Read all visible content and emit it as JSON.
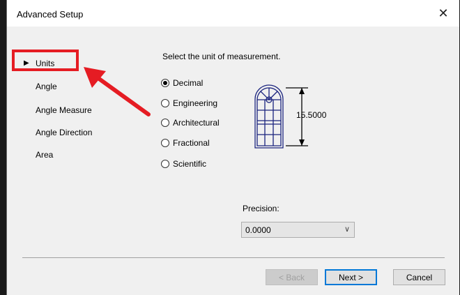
{
  "window": {
    "title": "Advanced Setup",
    "close_symbol": "✕"
  },
  "sidebar": {
    "items": [
      {
        "label": "Units",
        "selected": true
      },
      {
        "label": "Angle"
      },
      {
        "label": "Angle Measure"
      },
      {
        "label": "Angle Direction"
      },
      {
        "label": "Area"
      }
    ]
  },
  "main": {
    "prompt": "Select the unit of measurement.",
    "options": [
      {
        "label": "Decimal",
        "checked": true
      },
      {
        "label": "Engineering"
      },
      {
        "label": "Architectural"
      },
      {
        "label": "Fractional"
      },
      {
        "label": "Scientific"
      }
    ],
    "preview_value": "15.5000",
    "precision_label": "Precision:",
    "precision_value": "0.0000"
  },
  "footer": {
    "back": "< Back",
    "next": "Next >",
    "cancel": "Cancel"
  },
  "colors": {
    "annotation": "#e51c23",
    "accent": "#0078d7"
  }
}
